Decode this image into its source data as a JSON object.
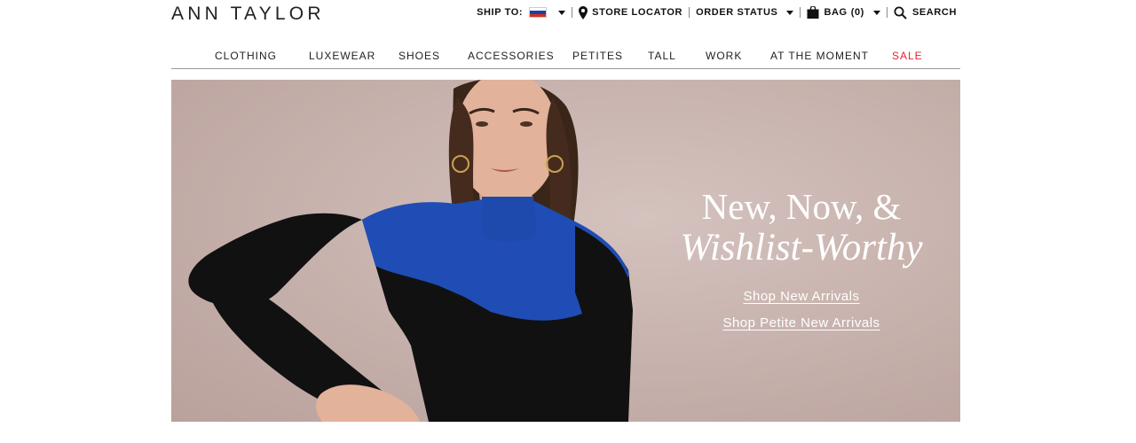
{
  "header": {
    "logo_text": "ANN TAYLOR",
    "ship_to_label": "SHIP TO:",
    "store_locator_label": "STORE LOCATOR",
    "order_status_label": "ORDER STATUS",
    "bag_label": "BAG",
    "bag_count": "(0)",
    "search_label": "SEARCH",
    "flag_country": "Russia"
  },
  "nav": {
    "items": [
      {
        "label": "CLOTHING"
      },
      {
        "label": "LUXEWEAR"
      },
      {
        "label": "SHOES"
      },
      {
        "label": "ACCESSORIES"
      },
      {
        "label": "PETITES"
      },
      {
        "label": "TALL"
      },
      {
        "label": "WORK"
      },
      {
        "label": "AT THE MOMENT"
      },
      {
        "label": "SALE"
      }
    ],
    "sale_color": "#e0262e"
  },
  "hero": {
    "headline_line1": "New, Now, &",
    "headline_line2": "Wishlist-Worthy",
    "link_primary": "Shop New Arrivals",
    "link_secondary": "Shop Petite New Arrivals",
    "background_color": "#c8b3ae",
    "sweater_blue": "#1f4db5",
    "sweater_black": "#111111"
  }
}
